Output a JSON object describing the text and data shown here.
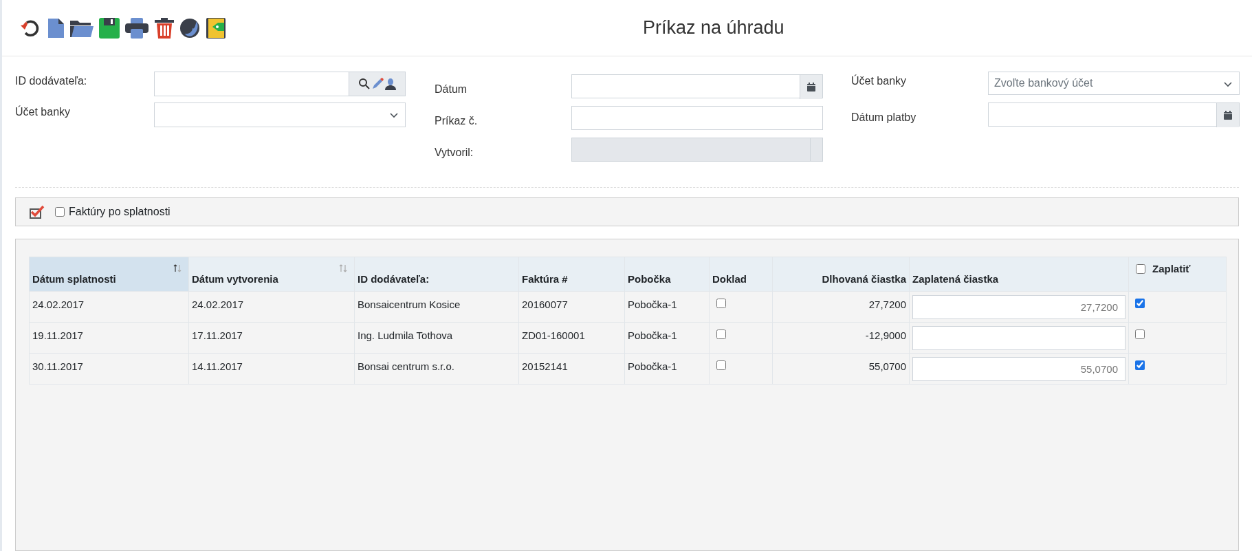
{
  "header": {
    "title": "Príkaz na úhradu"
  },
  "form": {
    "supplier_id": {
      "label": "ID dodávateľa:"
    },
    "bank_account_left": {
      "label": "Účet banky"
    },
    "date": {
      "label": "Dátum"
    },
    "order_no": {
      "label": "Príkaz č."
    },
    "created_by": {
      "label": "Vytvoril:",
      "disabled": true
    },
    "bank_account_right": {
      "label": "Účet banky",
      "placeholder": "Zvoľte bankový účet"
    },
    "payment_date": {
      "label": "Dátum platby"
    }
  },
  "filter": {
    "label": "Faktúry po splatnosti",
    "checked": false
  },
  "table": {
    "columns": [
      {
        "label": "Dátum splatnosti",
        "sortable": true,
        "sorted": true
      },
      {
        "label": "Dátum vytvorenia",
        "sortable": true,
        "sorted": false
      },
      {
        "label": "ID dodávateľa:",
        "sortable": false,
        "sorted": false
      },
      {
        "label": "Faktúra #",
        "sortable": false,
        "sorted": false
      },
      {
        "label": "Pobočka",
        "sortable": false,
        "sorted": false
      },
      {
        "label": "Doklad",
        "sortable": false,
        "sorted": false
      },
      {
        "label": "Dlhovaná čiastka",
        "sortable": false,
        "sorted": false
      },
      {
        "label": "Zaplatená čiastka",
        "sortable": false,
        "sorted": false
      },
      {
        "label": "Zaplatiť",
        "sortable": false,
        "sorted": false
      }
    ],
    "select_all_checked": false,
    "rows": [
      {
        "due_date": "24.02.2017",
        "created": "24.02.2017",
        "supplier": "Bonsaicentrum Kosice",
        "invoice": "20160077",
        "branch": "Pobočka-1",
        "document_checked": false,
        "owed": "27,7200",
        "paid": "27,7200",
        "pay_checked": true
      },
      {
        "due_date": "19.11.2017",
        "created": "17.11.2017",
        "supplier": "Ing. Ludmila Tothova",
        "invoice": "ZD01-160001",
        "branch": "Pobočka-1",
        "document_checked": false,
        "owed": "-12,9000",
        "pay_checked": false
      },
      {
        "due_date": "30.11.2017",
        "created": "14.11.2017",
        "supplier": "Bonsai centrum s.r.o.",
        "invoice": "20152141",
        "branch": "Pobočka-1",
        "document_checked": false,
        "owed": "55,0700",
        "paid": "55,0700",
        "pay_checked": true
      }
    ]
  }
}
